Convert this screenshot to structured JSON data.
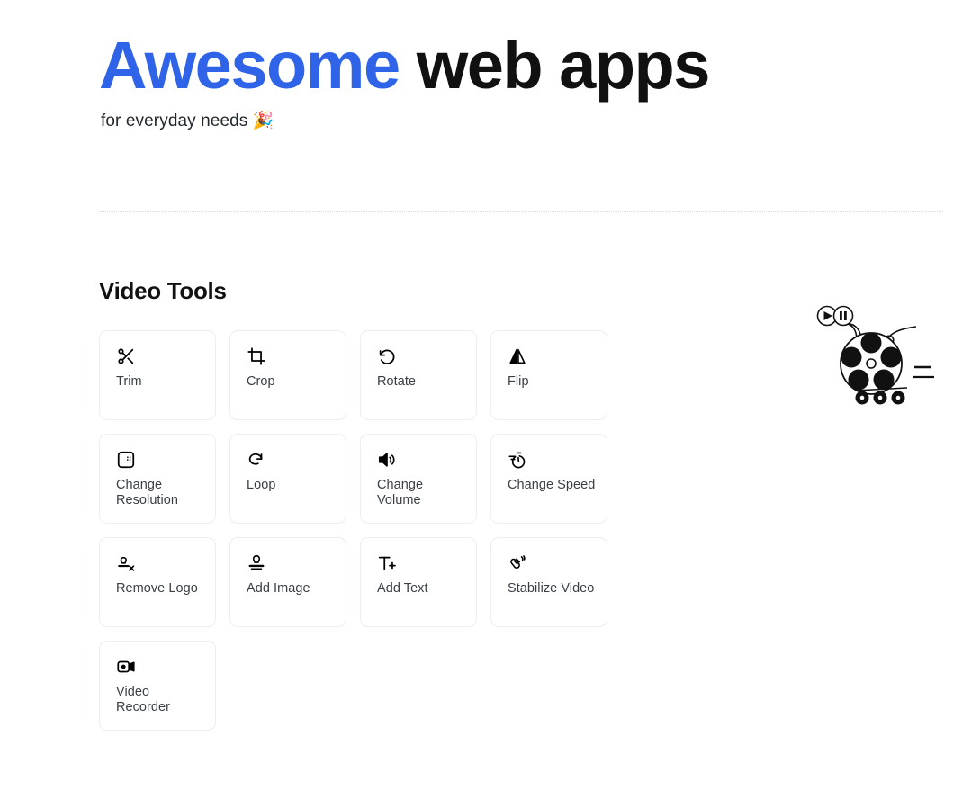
{
  "header": {
    "title_accent": "Awesome",
    "title_rest": " web apps",
    "subtitle": "for everyday needs",
    "subtitle_emoji": "🎉",
    "accent_color": "#2f64e8",
    "text_color": "#111111"
  },
  "section": {
    "title": "Video Tools",
    "cards": [
      {
        "label": "Trim",
        "icon": "scissors-icon",
        "wrap": false
      },
      {
        "label": "Crop",
        "icon": "crop-icon",
        "wrap": false
      },
      {
        "label": "Rotate",
        "icon": "rotate-ccw-icon",
        "wrap": false
      },
      {
        "label": "Flip",
        "icon": "flip-icon",
        "wrap": false
      },
      {
        "label": "Change Resolution",
        "icon": "resolution-icon",
        "wrap": true
      },
      {
        "label": "Loop",
        "icon": "loop-icon",
        "wrap": false
      },
      {
        "label": "Change Volume",
        "icon": "volume-icon",
        "wrap": true
      },
      {
        "label": "Change Speed",
        "icon": "speed-stopwatch-icon",
        "wrap": false
      },
      {
        "label": "Remove Logo",
        "icon": "stamp-remove-icon",
        "wrap": false
      },
      {
        "label": "Add Image",
        "icon": "stamp-icon",
        "wrap": false
      },
      {
        "label": "Add Text",
        "icon": "add-text-icon",
        "wrap": false
      },
      {
        "label": "Stabilize Video",
        "icon": "stabilize-hand-icon",
        "wrap": false
      },
      {
        "label": "Video Recorder",
        "icon": "camcorder-icon",
        "wrap": true
      }
    ]
  },
  "illustration": {
    "name": "film-reel-illustration",
    "parts": [
      "play-button",
      "pause-button",
      "film-reel",
      "film-strip-curl",
      "motion-lines",
      "reel-wheels"
    ]
  }
}
